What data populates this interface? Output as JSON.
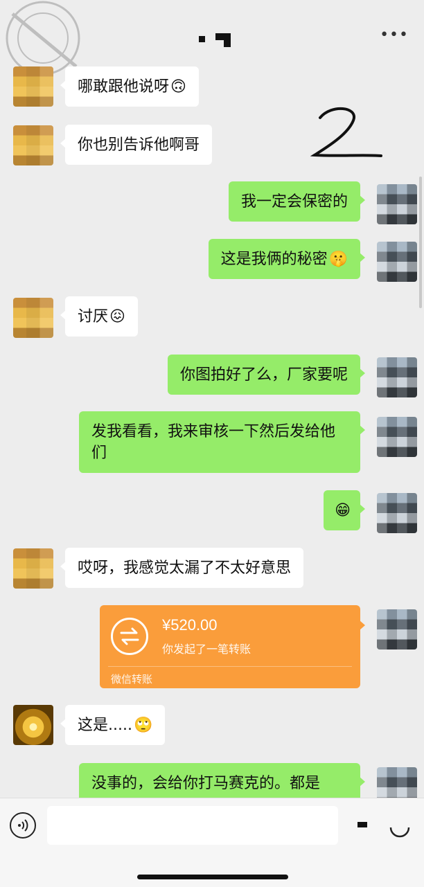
{
  "header": {
    "more_label": "•••"
  },
  "messages": [
    {
      "side": "in",
      "text": "哪敢跟他说呀",
      "emoji": "🙃"
    },
    {
      "side": "in",
      "text": "你也别告诉他啊哥",
      "emoji": ""
    },
    {
      "side": "out",
      "text": "我一定会保密的",
      "emoji": ""
    },
    {
      "side": "out",
      "text": "这是我俩的秘密",
      "emoji": "🤫"
    },
    {
      "side": "in",
      "text": "讨厌",
      "emoji": "😖"
    },
    {
      "side": "out",
      "text": "你图拍好了么，厂家要呢",
      "emoji": ""
    },
    {
      "side": "out",
      "text": "发我看看，我来审核一下然后发给他们",
      "emoji": ""
    },
    {
      "side": "out",
      "text": "",
      "emoji": "😁"
    },
    {
      "side": "in",
      "text": "哎呀，我感觉太漏了不太好意思",
      "emoji": ""
    },
    {
      "side": "in",
      "text": "这是.....",
      "emoji": "🙄"
    },
    {
      "side": "out",
      "text": "没事的，会给你打马赛克的。都是",
      "emoji": ""
    }
  ],
  "transfer": {
    "amount": "¥520.00",
    "description": "你发起了一笔转账",
    "footer": "微信转账",
    "color": "#fa9d3b"
  },
  "annotation": {
    "handwritten": "2"
  },
  "colors": {
    "background": "#ededed",
    "outgoing_bubble": "#95ec69",
    "incoming_bubble": "#ffffff"
  },
  "input": {
    "placeholder": ""
  }
}
